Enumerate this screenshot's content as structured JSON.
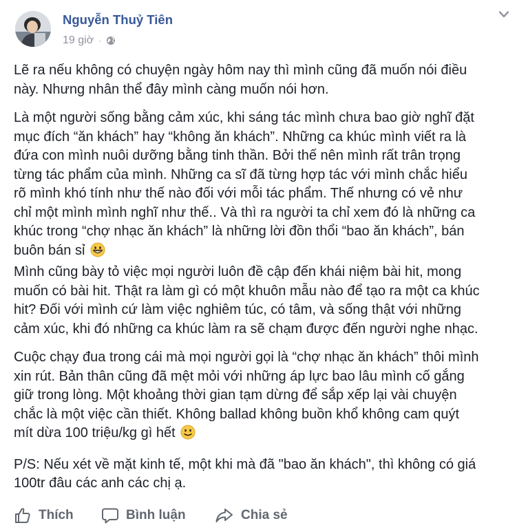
{
  "post": {
    "author": "Nguyễn Thuỷ Tiên",
    "time": "19 giờ",
    "separator": "·",
    "audience_icon": "globe-icon",
    "menu_icon": "chevron-down-icon",
    "paragraphs": [
      {
        "lines": [
          "Lẽ ra nếu không có chuyện ngày hôm nay thì mình cũng đã muốn nói điều",
          "này. Nhưng nhân thể đây mình càng muốn nói hơn."
        ]
      },
      {
        "lines": [
          "Là một người sống bằng cảm xúc, khi sáng tác mình chưa bao giờ nghĩ đặt",
          "mục đích “ăn khách” hay “không ăn khách”. Những ca khúc mình viết ra là",
          "đứa con mình nuôi dưỡng bằng tinh thần. Bởi thế nên mình rất trân trọng",
          "từng tác phẩm của mình. Những ca sĩ đã từng hợp tác với mình chắc hiểu",
          "rõ mình khó tính như thế nào đối với mỗi tác phẩm. Thế nhưng có vẻ như",
          "chỉ một mình mình nghĩ như thế.. Và thì ra người ta chỉ xem đó là những ca",
          "khúc trong “chợ nhạc ăn khách” là những lời đồn thổi “bao ăn khách”, bán",
          "buôn bán sỉ"
        ],
        "emoji": "grinning-emoji"
      },
      {
        "lines": [
          "Mình cũng bày tỏ việc mọi người luôn đề cập đến khái niệm bài hit, mong",
          "muốn có bài hit. Thật ra làm gì có một khuôn mẫu nào để tạo ra một ca khúc",
          "hit? Đối với mình cứ làm việc nghiêm túc, có tâm, và sống thật với những",
          "cảm xúc, khi đó những ca khúc làm ra sẽ chạm được đến người nghe nhạc."
        ]
      },
      {
        "lines": [
          "Cuộc chạy đua trong cái mà mọi người gọi là “chợ nhạc ăn khách” thôi mình",
          "xin rút. Bản thân cũng đã mệt mỏi với những áp lực bao lâu mình cố gắng",
          "giữ trong lòng. Một khoảng thời gian tạm dừng để sắp xếp lại vài chuyện",
          "chắc là một việc cần thiết. Không ballad không buồn khổ không cam quýt",
          "mít dừa 100 triệu/kg gì hết"
        ],
        "emoji": "smile-emoji"
      },
      {
        "lines": [
          "P/S: Nếu xét về mặt kinh tế, một khi mà đã \"bao ăn khách\", thì không có giá",
          "100tr đâu các anh các chị ạ."
        ]
      }
    ]
  },
  "actions": {
    "like": {
      "label": "Thích",
      "icon": "thumbs-up-icon"
    },
    "comment": {
      "label": "Bình luận",
      "icon": "comment-icon"
    },
    "share": {
      "label": "Chia sẻ",
      "icon": "share-icon"
    }
  },
  "colors": {
    "author_link": "#365899",
    "meta_text": "#90949c",
    "body_text": "#1d2129",
    "action_text": "#616770",
    "emoji_yellow": "#f7c948"
  }
}
